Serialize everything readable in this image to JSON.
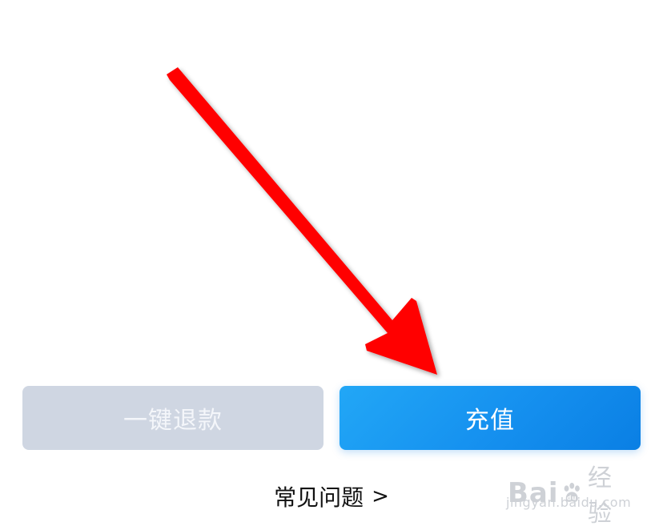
{
  "buttons": {
    "refund_label": "一键退款",
    "recharge_label": "充值"
  },
  "faq": {
    "label": "常见问题",
    "chevron": ">"
  },
  "watermark": {
    "brand_prefix": "Bai",
    "brand_suffix": "经验",
    "url": "jingyan.baidu.com",
    "icon": "baidu-paw-icon"
  },
  "annotation": {
    "icon": "red-arrow-icon",
    "color": "#ff0000"
  },
  "colors": {
    "recharge_start": "#22a7f6",
    "recharge_end": "#0a7fe4",
    "refund_bg": "#cfd6e2",
    "refund_text": "#f4f6fa"
  }
}
